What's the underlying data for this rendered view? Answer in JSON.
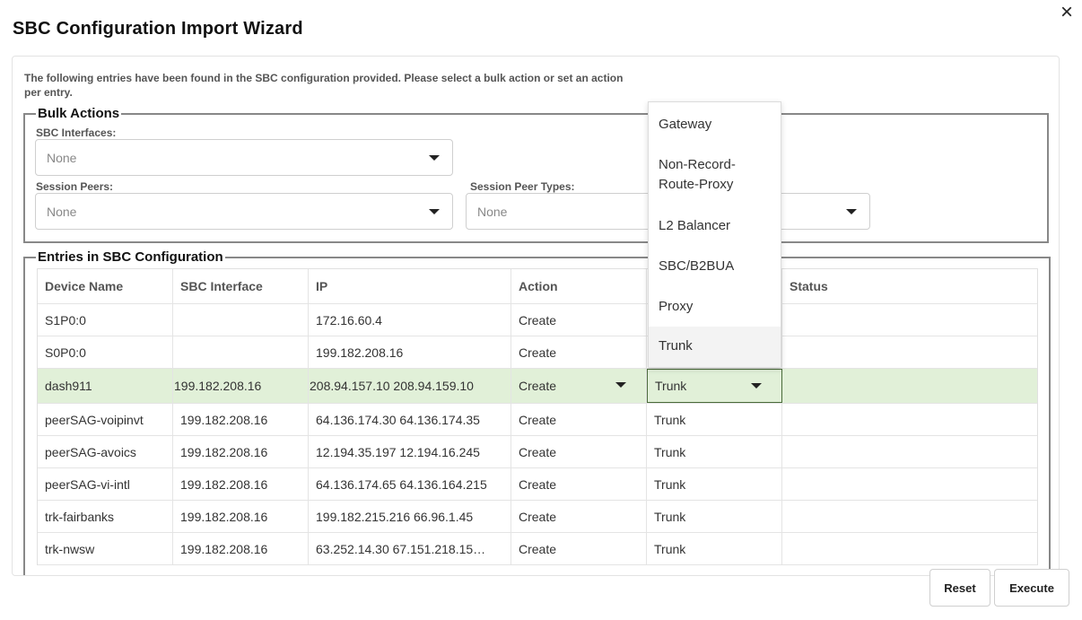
{
  "dialog": {
    "title": "SBC Configuration Import Wizard",
    "close_icon": "×",
    "intro": "The following entries have been found in the SBC configuration provided. Please select a bulk action or set an action per entry."
  },
  "bulk": {
    "legend": "Bulk Actions",
    "sbc_interfaces_label": "SBC Interfaces:",
    "sbc_interfaces_value": "None",
    "session_peers_label": "Session Peers:",
    "session_peers_value": "None",
    "session_peer_types_label": "Session Peer Types:",
    "session_peer_types_value": "None"
  },
  "entries": {
    "legend": "Entries in SBC Configuration",
    "columns": [
      "Device Name",
      "SBC Interface",
      "IP",
      "Action",
      "",
      "Status"
    ],
    "rows": [
      [
        "S1P0:0",
        "",
        "172.16.60.4",
        "Create",
        "",
        ""
      ],
      [
        "S0P0:0",
        "",
        "199.182.208.16",
        "Create",
        "",
        ""
      ],
      [
        "dash911",
        "199.182.208.16",
        "208.94.157.10 208.94.159.10",
        "Create",
        "Trunk",
        ""
      ],
      [
        "peerSAG-voipinvt",
        "199.182.208.16",
        "64.136.174.30 64.136.174.35",
        "Create",
        "Trunk",
        ""
      ],
      [
        "peerSAG-avoics",
        "199.182.208.16",
        "12.194.35.197 12.194.16.245",
        "Create",
        "Trunk",
        ""
      ],
      [
        "peerSAG-vi-intl",
        "199.182.208.16",
        "64.136.174.65 64.136.164.215",
        "Create",
        "Trunk",
        ""
      ],
      [
        "trk-fairbanks",
        "199.182.208.16",
        "199.182.215.216 66.96.1.45",
        "Create",
        "Trunk",
        ""
      ],
      [
        "trk-nwsw",
        "199.182.208.16",
        "63.252.14.30 67.151.218.15…",
        "Create",
        "Trunk",
        ""
      ]
    ]
  },
  "dropdown": {
    "options": [
      "Gateway",
      "Non-Record-Route-Proxy",
      "L2 Balancer",
      "SBC/B2BUA",
      "Proxy",
      "Trunk"
    ]
  },
  "footer": {
    "reset_label": "Reset",
    "execute_label": "Execute"
  },
  "colors": {
    "selected_row": "#e1f0d8",
    "selected_cell_border": "#4a6b3a"
  }
}
